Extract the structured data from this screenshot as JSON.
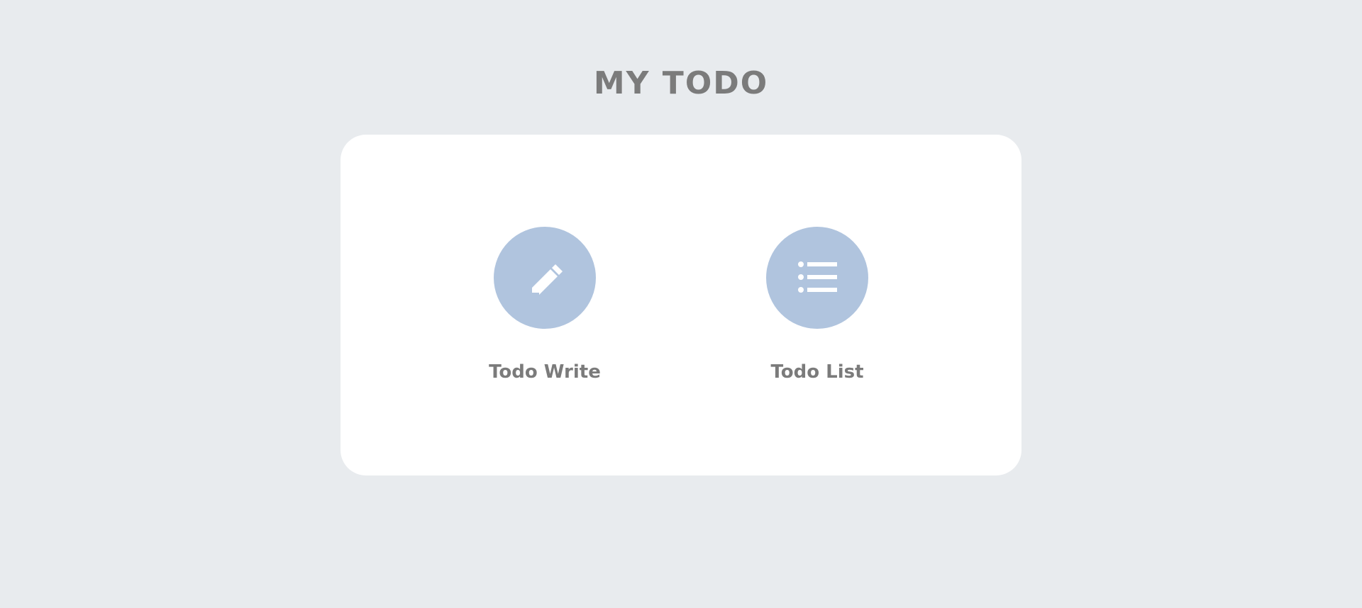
{
  "header": {
    "title": "MY TODO"
  },
  "menu": {
    "items": [
      {
        "label": "Todo Write",
        "icon": "pencil-icon"
      },
      {
        "label": "Todo List",
        "icon": "list-icon"
      }
    ]
  },
  "colors": {
    "background": "#e8ebee",
    "card": "#ffffff",
    "accent": "#b0c4de",
    "text": "#7b7b7b"
  }
}
